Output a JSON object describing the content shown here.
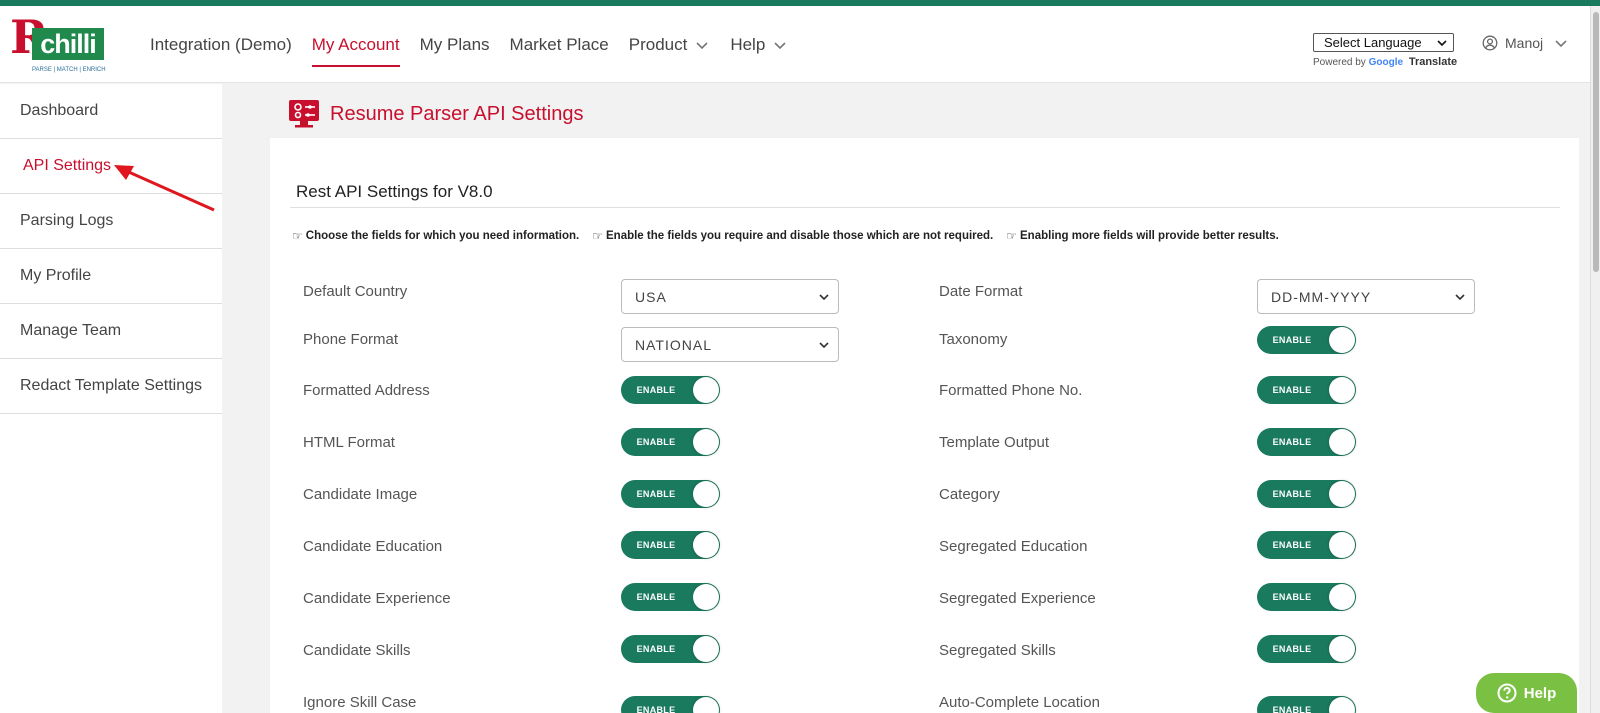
{
  "brand": {
    "logo_letter": "R",
    "logo_word": "chilli",
    "tagline": "PARSE | MATCH | ENRICH",
    "accent": "#c8102e",
    "green": "#1a7a5e"
  },
  "nav": {
    "integration": "Integration (Demo)",
    "my_account": "My Account",
    "my_plans": "My Plans",
    "market_place": "Market Place",
    "product": "Product",
    "help": "Help"
  },
  "language": {
    "selected": "Select Language",
    "powered_by": "Powered by",
    "google": "Google",
    "translate": "Translate"
  },
  "user": {
    "name": "Manoj"
  },
  "sidebar": {
    "items": [
      {
        "label": "Dashboard"
      },
      {
        "label": "API Settings"
      },
      {
        "label": "Parsing Logs"
      },
      {
        "label": "My Profile"
      },
      {
        "label": "Manage Team"
      },
      {
        "label": "Redact Template Settings"
      }
    ]
  },
  "page": {
    "title": "Resume Parser API Settings",
    "section_title": "Rest API Settings for V8.0",
    "hints": [
      "Choose the fields for which you need information.",
      "Enable the fields you require and disable those which are not required.",
      "Enabling more fields will provide better results."
    ]
  },
  "settings": {
    "toggle_label": "ENABLE",
    "left": [
      {
        "label": "Default Country",
        "type": "select",
        "value": "USA"
      },
      {
        "label": "Phone Format",
        "type": "select",
        "value": "NATIONAL"
      },
      {
        "label": "Formatted Address",
        "type": "toggle",
        "enabled": true
      },
      {
        "label": "HTML Format",
        "type": "toggle",
        "enabled": true
      },
      {
        "label": "Candidate Image",
        "type": "toggle",
        "enabled": true
      },
      {
        "label": "Candidate Education",
        "type": "toggle",
        "enabled": true
      },
      {
        "label": "Candidate Experience",
        "type": "toggle",
        "enabled": true
      },
      {
        "label": "Candidate Skills",
        "type": "toggle",
        "enabled": true
      },
      {
        "label": "Ignore Skill Case",
        "type": "toggle",
        "enabled": true
      }
    ],
    "right": [
      {
        "label": "Date Format",
        "type": "select",
        "value": "DD-MM-YYYY"
      },
      {
        "label": "Taxonomy",
        "type": "toggle",
        "enabled": true
      },
      {
        "label": "Formatted Phone No.",
        "type": "toggle",
        "enabled": true
      },
      {
        "label": "Template Output",
        "type": "toggle",
        "enabled": true
      },
      {
        "label": "Category",
        "type": "toggle",
        "enabled": true
      },
      {
        "label": "Segregated Education",
        "type": "toggle",
        "enabled": true
      },
      {
        "label": "Segregated Experience",
        "type": "toggle",
        "enabled": true
      },
      {
        "label": "Segregated Skills",
        "type": "toggle",
        "enabled": true
      },
      {
        "label": "Auto-Complete Location",
        "type": "toggle",
        "enabled": true
      }
    ]
  },
  "help_button": {
    "label": "Help"
  }
}
